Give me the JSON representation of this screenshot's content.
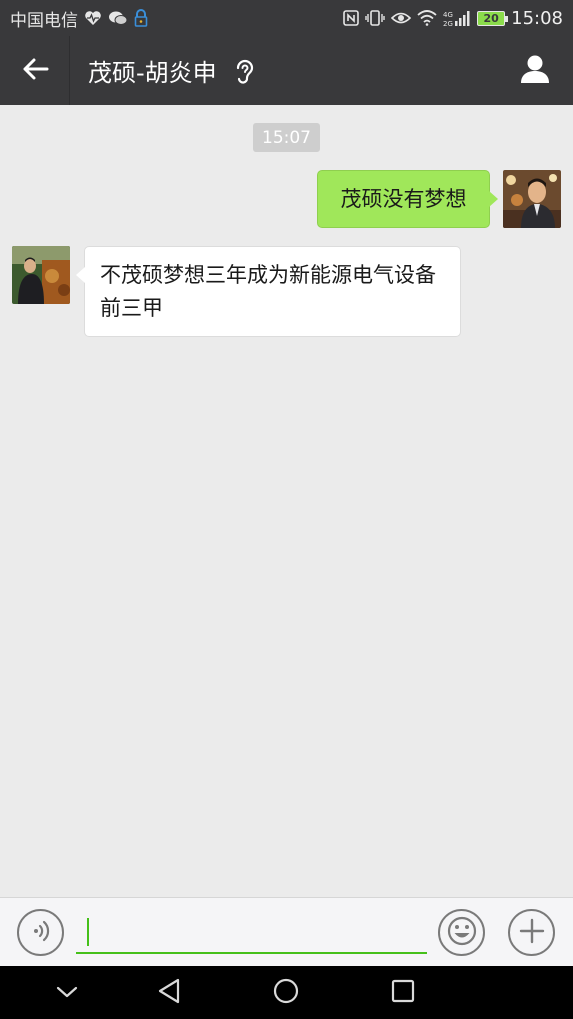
{
  "status_bar": {
    "carrier": "中国电信",
    "battery": "20",
    "time": "15:08",
    "icons_left": [
      "heart-monitor-icon",
      "wechat-icon",
      "lock-icon"
    ],
    "icons_right": [
      "nfc-icon",
      "vibrate-icon",
      "eye-icon",
      "wifi-icon",
      "signal-icon",
      "battery-icon"
    ]
  },
  "header": {
    "title": "茂硕-胡炎申",
    "back_icon": "arrow-left-icon",
    "ear_icon": "earpiece-icon",
    "profile_icon": "person-icon"
  },
  "chat": {
    "timestamp": "15:07",
    "messages": [
      {
        "side": "right",
        "text": "茂硕没有梦想",
        "bubble_color": "#a0e75a"
      },
      {
        "side": "left",
        "text": "不茂硕梦想三年成为新能源电气设备前三甲",
        "bubble_color": "#ffffff"
      }
    ]
  },
  "input_bar": {
    "value": "",
    "accent": "#45c01a",
    "voice_icon": "voice-icon",
    "emoji_icon": "emoji-icon",
    "plus_icon": "plus-icon"
  },
  "nav_bar": {
    "buttons": [
      "chevron-down-icon",
      "nav-back-icon",
      "nav-home-icon",
      "nav-recent-icon"
    ]
  }
}
